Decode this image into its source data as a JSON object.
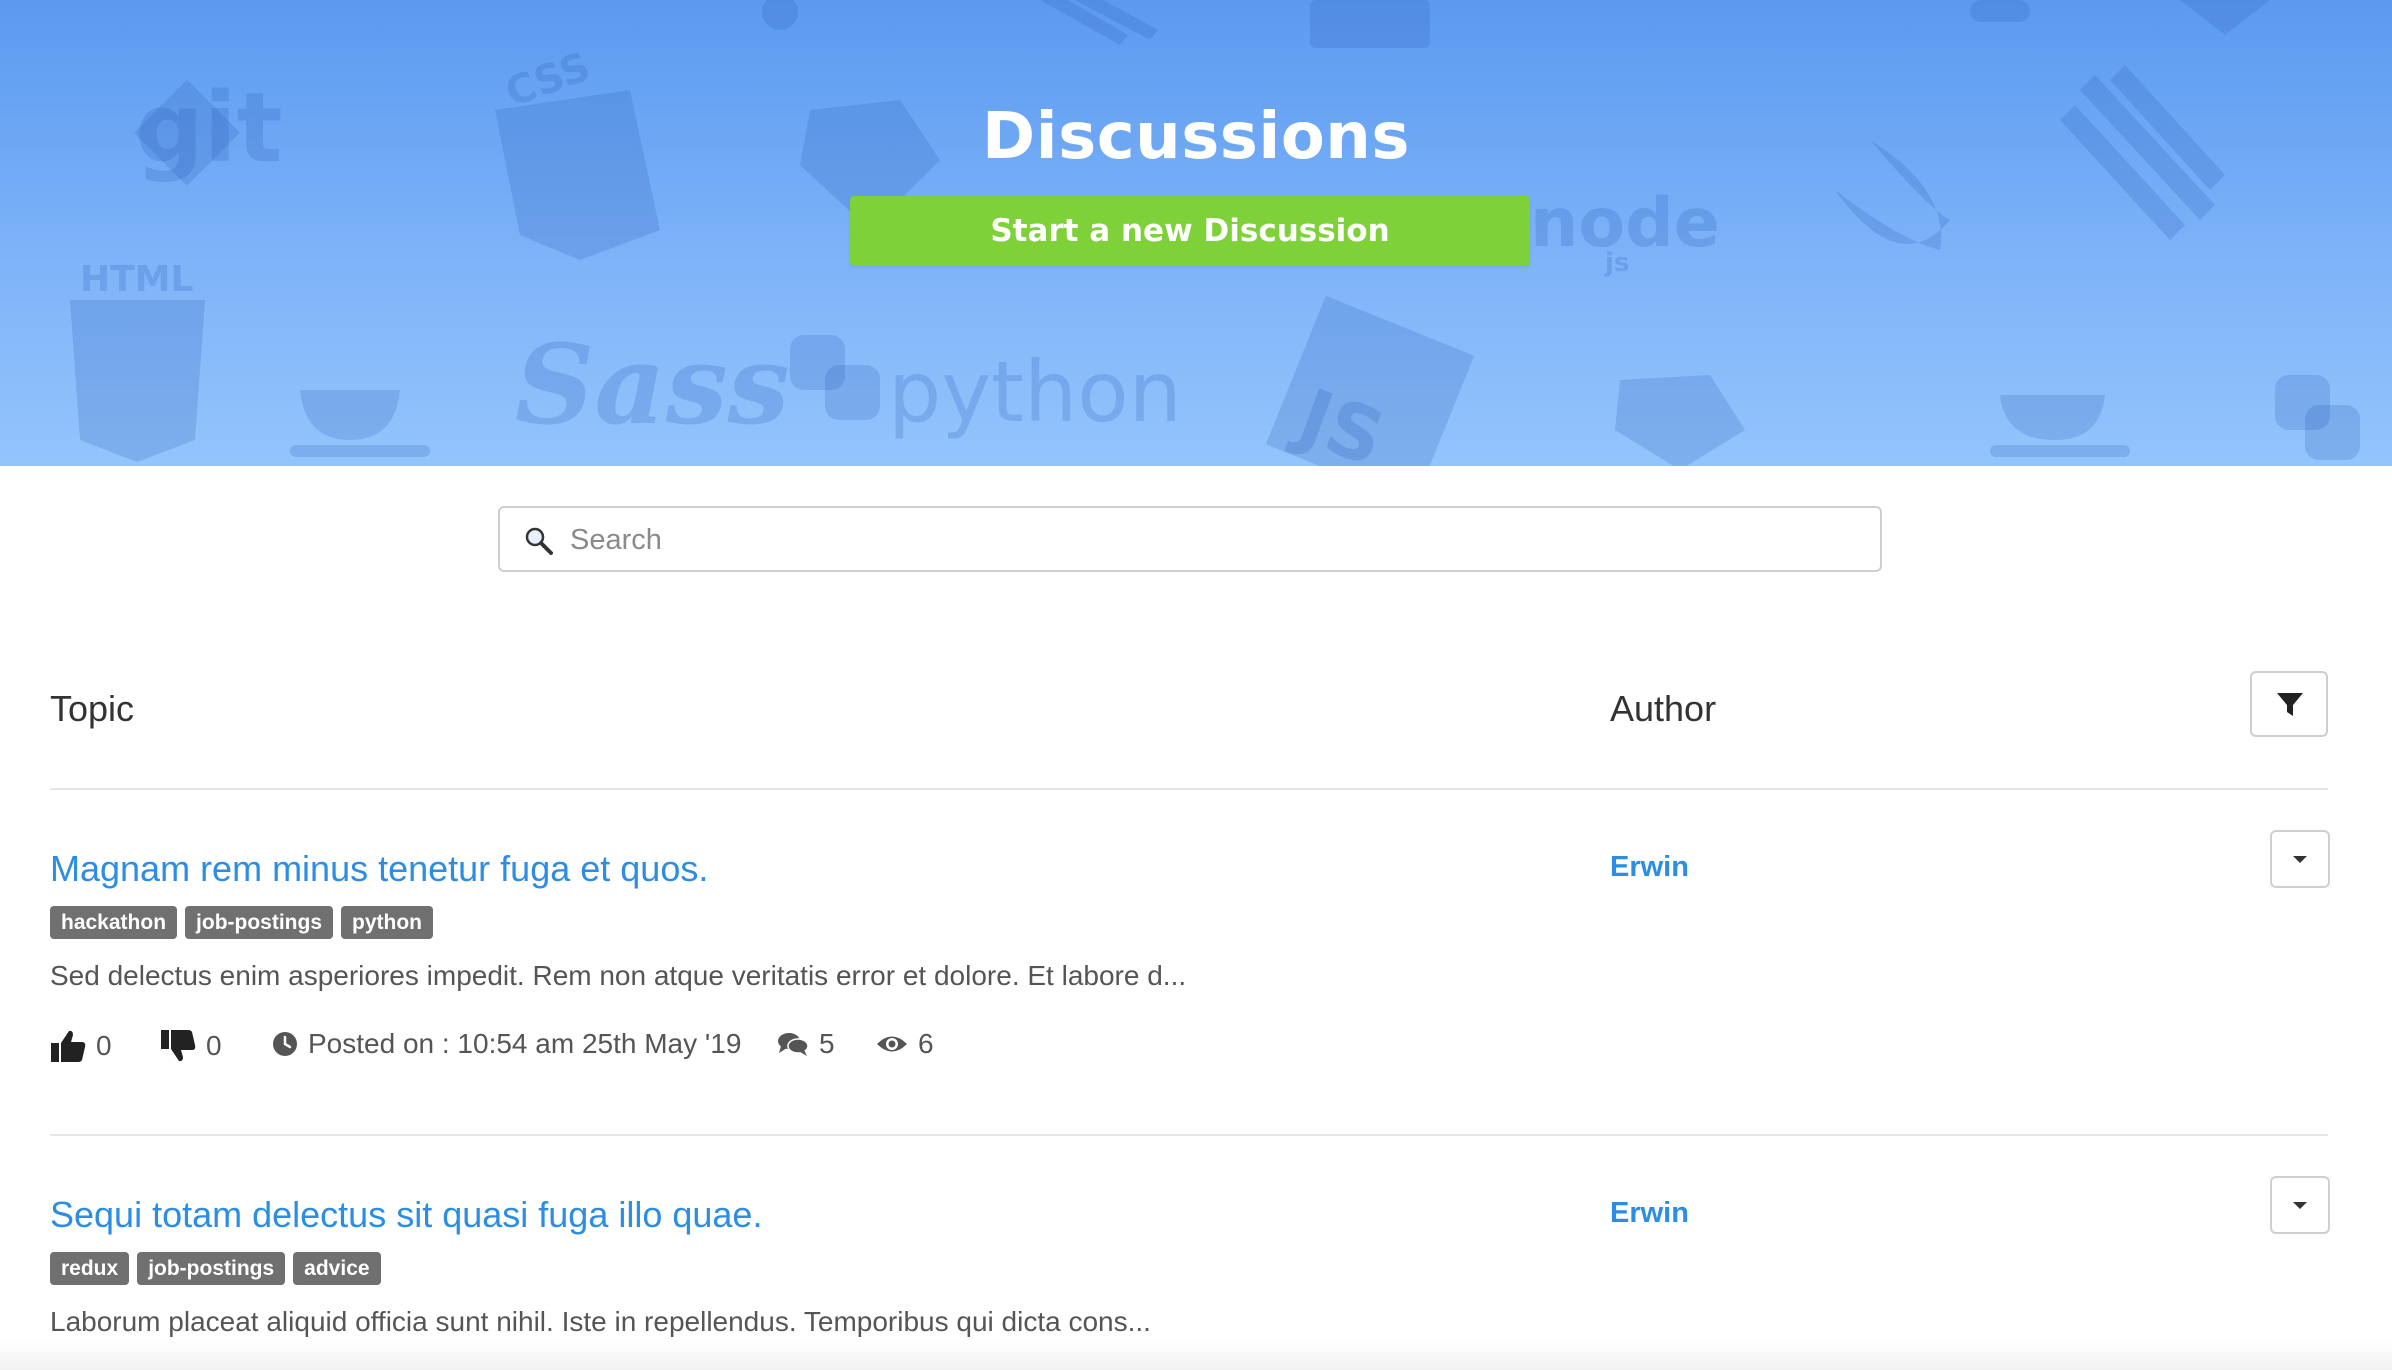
{
  "hero": {
    "title": "Discussions",
    "new_button_label": "Start a new Discussion",
    "background_logos": [
      "git",
      "CSS",
      "HTML",
      "Sass",
      "python",
      "node",
      "JS",
      "js"
    ]
  },
  "search": {
    "placeholder": "Search",
    "value": ""
  },
  "table": {
    "topic_header": "Topic",
    "author_header": "Author",
    "filter_icon": "filter-icon"
  },
  "discussions": [
    {
      "title": "Magnam rem minus tenetur fuga et quos.",
      "author": "Erwin",
      "tags": [
        "hackathon",
        "job-postings",
        "python"
      ],
      "excerpt": "Sed delectus enim asperiores impedit. Rem non atque veritatis error et dolore. Et labore d...",
      "likes": "0",
      "dislikes": "0",
      "posted": "Posted on : 10:54 am 25th May '19",
      "comments": "5",
      "views": "6"
    },
    {
      "title": "Sequi totam delectus sit quasi fuga illo quae.",
      "author": "Erwin",
      "tags": [
        "redux",
        "job-postings",
        "advice"
      ],
      "excerpt": "Laborum placeat aliquid officia sunt nihil. Iste in repellendus. Temporibus qui dicta cons..."
    }
  ],
  "colors": {
    "hero_top": "#5b9af0",
    "hero_bottom": "#94c4fc",
    "button_green": "#7ed138",
    "link_blue": "#2b8de3",
    "tag_gray": "#707070"
  }
}
